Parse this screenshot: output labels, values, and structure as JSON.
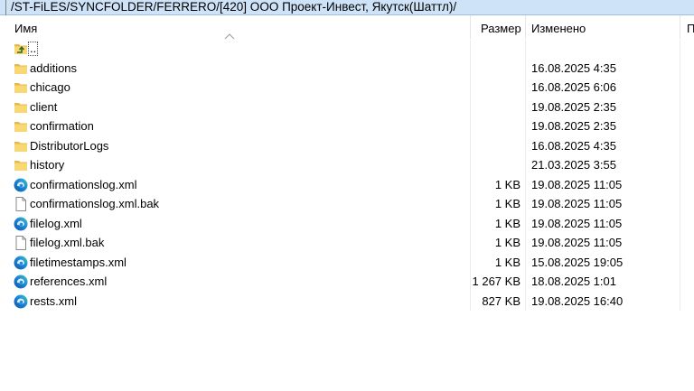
{
  "path": "/ST-FiLES/SYNCFOLDER/FERRERO/[420] ООО Проект-Инвест, Якутск(Шаттл)/",
  "columns": {
    "name": "Имя",
    "size": "Размер",
    "modified": "Изменено",
    "extra": "П"
  },
  "rows": [
    {
      "type": "up",
      "name": "..",
      "size": "",
      "date": ""
    },
    {
      "type": "folder",
      "name": "additions",
      "size": "",
      "date": "16.08.2025 4:35"
    },
    {
      "type": "folder",
      "name": "chicago",
      "size": "",
      "date": "16.08.2025 6:06"
    },
    {
      "type": "folder",
      "name": "client",
      "size": "",
      "date": "19.08.2025 2:35"
    },
    {
      "type": "folder",
      "name": "confirmation",
      "size": "",
      "date": "19.08.2025 2:35"
    },
    {
      "type": "folder",
      "name": "DistributorLogs",
      "size": "",
      "date": "16.08.2025 4:35"
    },
    {
      "type": "folder",
      "name": "history",
      "size": "",
      "date": "21.03.2025 3:55"
    },
    {
      "type": "xml",
      "name": "confirmationslog.xml",
      "size": "1 KB",
      "date": "19.08.2025 11:05"
    },
    {
      "type": "file",
      "name": "confirmationslog.xml.bak",
      "size": "1 KB",
      "date": "19.08.2025 11:05"
    },
    {
      "type": "xml",
      "name": "filelog.xml",
      "size": "1 KB",
      "date": "19.08.2025 11:05"
    },
    {
      "type": "file",
      "name": "filelog.xml.bak",
      "size": "1 KB",
      "date": "19.08.2025 11:05"
    },
    {
      "type": "xml",
      "name": "filetimestamps.xml",
      "size": "1 KB",
      "date": "15.08.2025 19:05"
    },
    {
      "type": "xml",
      "name": "references.xml",
      "size": "1 267 KB",
      "date": "18.08.2025 1:01"
    },
    {
      "type": "xml",
      "name": "rests.xml",
      "size": "827 KB",
      "date": "19.08.2025 16:40"
    }
  ],
  "icons": {
    "folder": "folder-icon",
    "xml": "edge-xml-icon",
    "file": "blank-file-icon",
    "up": "parent-directory-icon"
  },
  "colors": {
    "pathbar": "#cfe3f8",
    "folder": "#f8d775",
    "edge_blue": "#0c59a4",
    "edge_green": "#4ad1a0"
  }
}
